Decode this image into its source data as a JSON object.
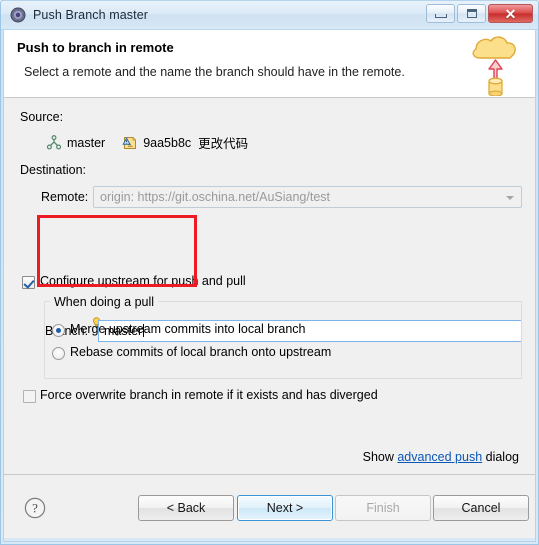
{
  "window": {
    "title": "Push Branch master",
    "icon": "push-branch-icon",
    "controls": {
      "minimize": "minimize-button",
      "maximize": "maximize-button",
      "close": "close-button",
      "close_glyph": "✕"
    }
  },
  "header": {
    "title": "Push to branch in remote",
    "description": "Select a remote and the name the branch should have in the remote.",
    "graphic": "cloud-upload-icon"
  },
  "source": {
    "label": "Source:",
    "branch_icon": "git-branch-icon",
    "branch_name": "master",
    "commit_icon": "commit-note-icon",
    "commit_id": "9aa5b8c",
    "commit_message": "更改代码"
  },
  "destination": {
    "label": "Destination:",
    "remote": {
      "label": "Remote:",
      "value": "origin: https://git.oschina.net/AuSiang/test",
      "enabled": false
    },
    "branch": {
      "label": "Branch:",
      "value": "master",
      "hint_icon": "content-assist-bulb-icon"
    }
  },
  "upstream": {
    "configure_label": "Configure upstream for push and pull",
    "configure_checked": true,
    "group_title": "When doing a pull",
    "options": [
      {
        "label": "Merge upstream commits into local branch",
        "selected": true
      },
      {
        "label": "Rebase commits of local branch onto upstream",
        "selected": false
      }
    ]
  },
  "force": {
    "label": "Force overwrite branch in remote if it exists and has diverged",
    "checked": false
  },
  "advanced": {
    "prefix": "Show ",
    "link": "advanced push",
    "suffix": " dialog"
  },
  "footer": {
    "help": "?",
    "buttons": [
      {
        "label": "< Back",
        "state": "normal"
      },
      {
        "label": "Next >",
        "state": "default"
      },
      {
        "label": "Finish",
        "state": "disabled"
      },
      {
        "label": "Cancel",
        "state": "normal"
      }
    ]
  },
  "colors": {
    "accent": "#3c93d3",
    "link": "#0b57b8",
    "annotation": "#ed1c24",
    "dialog_bg": "#f0f0f0"
  }
}
